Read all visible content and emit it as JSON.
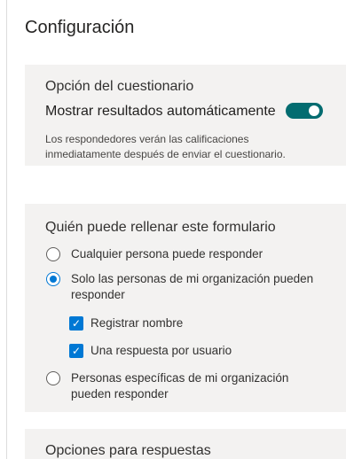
{
  "panel_title": "Configuración",
  "quiz_options": {
    "heading": "Opción del cuestionario",
    "show_results_label": "Mostrar resultados automáticamente",
    "toggle_on": true,
    "description": "Los respondedores verán las calificaciones inmediatamente después de enviar el cuestionario."
  },
  "who_can_fill": {
    "heading": "Quién puede rellenar este formulario",
    "options": [
      {
        "label": "Cualquier persona puede responder",
        "selected": false
      },
      {
        "label": "Solo las personas de mi organización pueden responder",
        "selected": true
      },
      {
        "label": "Personas específicas de mi organización pueden responder",
        "selected": false
      }
    ],
    "sub_options": [
      {
        "label": "Registrar nombre",
        "checked": true
      },
      {
        "label": "Una respuesta por usuario",
        "checked": true
      }
    ]
  },
  "response_options": {
    "heading": "Opciones para respuestas"
  },
  "colors": {
    "accent": "#0078d4",
    "toggle": "#036c70",
    "section_bg": "#f3f2f1"
  }
}
